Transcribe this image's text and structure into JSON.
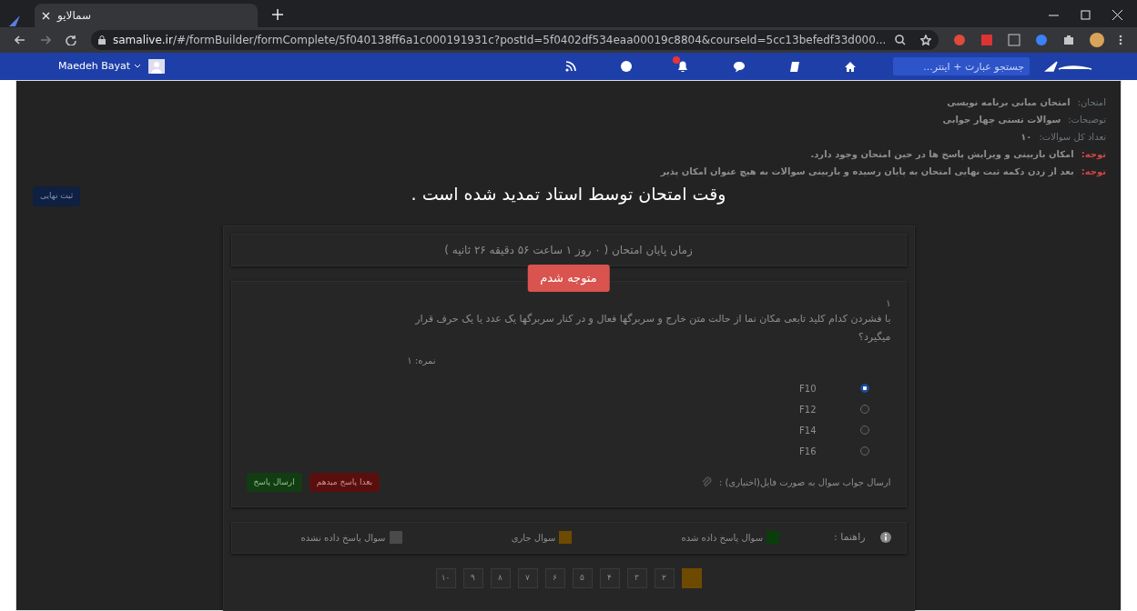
{
  "browser": {
    "tab_title": "سمالایو",
    "url_host": "samalive.ir",
    "url_path": "/#/formBuilder/formComplete/5f040138ff6a1c000191931c?postId=5f0402df534eaa00019c8804&courseId=5cc13befedf33d000..."
  },
  "navbar": {
    "user": "Maedeh Bayat",
    "search_placeholder": "جستجو عبارت + اینتر..."
  },
  "exam_info": [
    {
      "kind": "info",
      "label": "امتحان:",
      "value": "امتحان مبانی برنامه نویسی"
    },
    {
      "kind": "info",
      "label": "توضیحات:",
      "value": "سوالات تستی چهار جوابی"
    },
    {
      "kind": "info",
      "label": "تعداد کل سوالات:",
      "value": "۱۰"
    },
    {
      "kind": "warning",
      "label": "توجه:",
      "value": "امکان بازبینی و ویرایش پاسخ ها در حین امتحان وجود دارد."
    },
    {
      "kind": "warning",
      "label": "توجه:",
      "value": "بعد از زدن دکمه ثبت نهایی امتحان به پایان رسیده و بازبینی سوالات به هیچ عنوان امکان پذیر"
    }
  ],
  "submit_button": "ثبت نهایی",
  "timer": "زمان پایان امتحان ( ۰ روز ۱ ساعت ۵۶ دقیقه ۲۶ ثانیه )",
  "question": {
    "number": "۱",
    "text": "با فشردن کدام کلید تابعی مکان نما از حالت متن خارج و سربرگها فعال و در کنار سربرگها یک عدد یا یک حرف قرار میگیرد؟",
    "score": "نمره: ۱",
    "options": [
      {
        "label": "F10",
        "selected": true
      },
      {
        "label": "F12",
        "selected": false
      },
      {
        "label": "F14",
        "selected": false
      },
      {
        "label": "F16",
        "selected": false
      }
    ],
    "attachment_label": "ارسال جواب سوال به صورت فایل(اختیاری) :",
    "buttons": [
      {
        "kind": "danger",
        "label": "بعدا پاسخ میدهم"
      },
      {
        "kind": "success",
        "label": "ارسال پاسخ"
      }
    ]
  },
  "legend": {
    "title": "راهنما :",
    "items": [
      {
        "label": "سوال پاسخ داده شده",
        "color": "#0b3d0b"
      },
      {
        "label": "سوال جاری",
        "color": "#6e4a00"
      },
      {
        "label": "سوال پاسخ داده نشده",
        "color": "#4a4a4a"
      }
    ]
  },
  "pages": [
    {
      "selected": true
    },
    {
      "label": "۲",
      "selected": false
    },
    {
      "label": "۳",
      "selected": false
    },
    {
      "label": "۴",
      "selected": false
    },
    {
      "label": "۵",
      "selected": false
    },
    {
      "label": "۶",
      "selected": false
    },
    {
      "label": "۷",
      "selected": false
    },
    {
      "label": "۸",
      "selected": false
    },
    {
      "label": "۹",
      "selected": false
    },
    {
      "label": "۱۰",
      "selected": false
    }
  ],
  "modal": {
    "message": "وقت امتحان توسط استاد تمدید شده است .",
    "button": "متوجه شدم"
  }
}
